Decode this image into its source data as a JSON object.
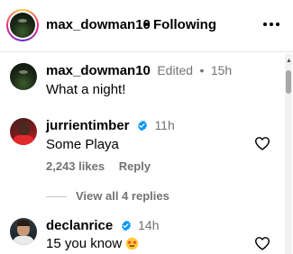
{
  "header": {
    "username": "max_dowman10",
    "separator": "•",
    "follow_status": "Following",
    "more_icon": "more-horizontal-icon"
  },
  "caption": {
    "username": "max_dowman10",
    "edited": "Edited",
    "separator": "•",
    "time": "15h",
    "text": "What a night!"
  },
  "comments": [
    {
      "username": "jurrientimber",
      "verified": true,
      "time": "11h",
      "text": "Some Playa",
      "likes": "2,243 likes",
      "reply_label": "Reply"
    },
    {
      "username": "declanrice",
      "verified": true,
      "time": "14h",
      "text": "15 you know",
      "emoji": "star-struck-emoji"
    }
  ],
  "view_replies": "View all 4 replies",
  "colors": {
    "verified": "#0095f6",
    "muted": "#737373"
  }
}
